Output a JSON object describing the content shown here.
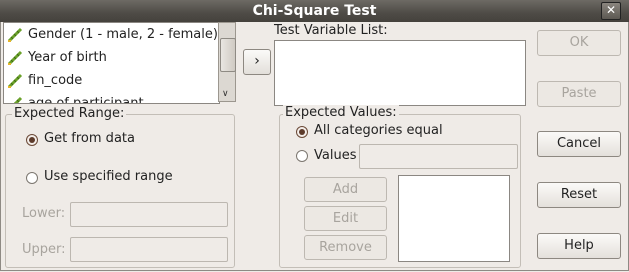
{
  "window": {
    "title": "Chi-Square Test",
    "close_glyph": "✕"
  },
  "variables": [
    {
      "label": "Gender (1 - male, 2 - female)",
      "icon": "ruler-icon"
    },
    {
      "label": "Year of birth",
      "icon": "ruler-icon"
    },
    {
      "label": "fin_code",
      "icon": "ruler-icon"
    },
    {
      "label": "age of participant",
      "icon": "ruler-icon"
    }
  ],
  "move_button": "›",
  "test_variable_list": {
    "label": "Test Variable List:"
  },
  "buttons": {
    "ok": "OK",
    "paste": "Paste",
    "cancel": "Cancel",
    "reset": "Reset",
    "help": "Help"
  },
  "expected_range": {
    "title": "Expected Range:",
    "get_from_data": "Get from data",
    "use_specified": "Use specified range",
    "selected": "get_from_data",
    "lower_label": "Lower:",
    "upper_label": "Upper:"
  },
  "expected_values": {
    "title": "Expected Values:",
    "all_equal": "All categories equal",
    "values": "Values",
    "selected": "all_equal",
    "add": "Add",
    "edit": "Edit",
    "remove": "Remove"
  },
  "colors": {
    "accent_radio": "#5c3a2a",
    "icon_green": "#6aa12a"
  }
}
